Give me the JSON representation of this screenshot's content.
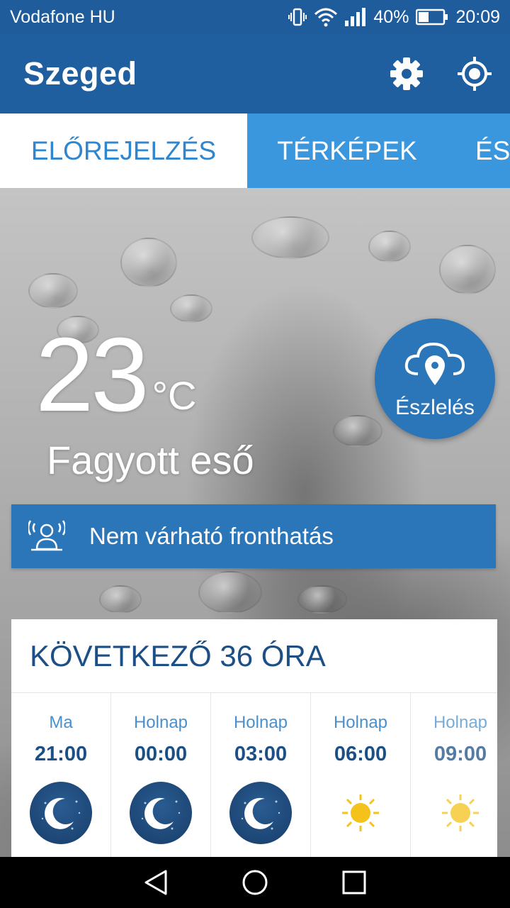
{
  "status_bar": {
    "carrier": "Vodafone HU",
    "battery": "40%",
    "time": "20:09",
    "icons": [
      "vibrate-icon",
      "wifi-icon",
      "signal-icon",
      "battery-icon"
    ]
  },
  "app_bar": {
    "title": "Szeged",
    "actions": [
      "settings-gear-icon",
      "location-target-icon"
    ]
  },
  "tabs": [
    {
      "label": "ELŐREJELZÉS",
      "active": true
    },
    {
      "label": "TÉRKÉPEK",
      "active": false
    },
    {
      "label": "ÉS",
      "active": false
    }
  ],
  "current": {
    "temperature": "23",
    "unit": "°C",
    "condition": "Fagyott eső"
  },
  "report_button": {
    "label": "Észlelés",
    "icon": "cloud-location-icon"
  },
  "front_banner": {
    "icon": "person-alert-icon",
    "text": "Nem várható fronthatás"
  },
  "forecast": {
    "title": "KÖVETKEZŐ 36 ÓRA",
    "hours": [
      {
        "day": "Ma",
        "time": "21:00",
        "icon": "moon-night-icon"
      },
      {
        "day": "Holnap",
        "time": "00:00",
        "icon": "moon-night-icon"
      },
      {
        "day": "Holnap",
        "time": "03:00",
        "icon": "moon-night-icon"
      },
      {
        "day": "Holnap",
        "time": "06:00",
        "icon": "sun-icon"
      },
      {
        "day": "Holnap",
        "time": "09:00",
        "icon": "sun-icon"
      }
    ]
  },
  "colors": {
    "primary": "#1f5f9f",
    "tab_bar": "#3a97dd",
    "accent_text": "#1b4f86",
    "sun": "#f5c21b"
  },
  "nav_bar": {
    "buttons": [
      "back-icon",
      "home-icon",
      "recents-icon"
    ]
  }
}
